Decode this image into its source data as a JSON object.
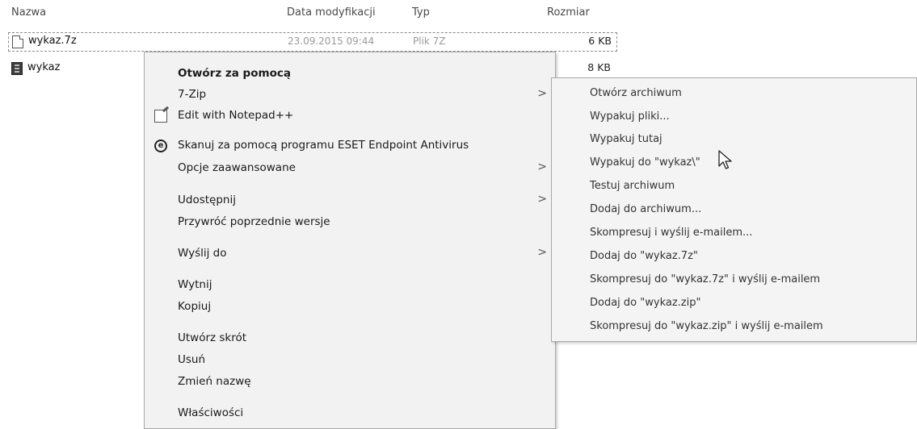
{
  "columns": {
    "name": "Nazwa",
    "modified": "Data modyfikacji",
    "type": "Typ",
    "size": "Rozmiar"
  },
  "files": [
    {
      "name": "wykaz.7z",
      "modified": "23.09.2015 09:44",
      "type": "Plik 7Z",
      "size": "6 KB",
      "icon": "file-doc-icon"
    },
    {
      "name": "wykaz",
      "modified": "",
      "type": "",
      "size": "8 KB",
      "icon": "archive-folder-icon"
    }
  ],
  "context_menu": {
    "items": [
      {
        "label": "Otwórz za pomocą",
        "bold": true
      },
      {
        "label": "7-Zip",
        "submenu": true
      },
      {
        "label": "Edit with Notepad++",
        "icon": "notepad-plus-icon"
      },
      {
        "label": "Skanuj za pomocą programu ESET Endpoint Antivirus",
        "icon": "eset-icon"
      },
      {
        "label": "Opcje zaawansowane",
        "submenu": true
      },
      {
        "label": "Udostępnij",
        "submenu": true
      },
      {
        "label": "Przywróć poprzednie wersje"
      },
      {
        "label": "Wyślij do",
        "submenu": true
      },
      {
        "label": "Wytnij"
      },
      {
        "label": "Kopiuj"
      },
      {
        "label": "Utwórz skrót"
      },
      {
        "label": "Usuń"
      },
      {
        "label": "Zmień nazwę"
      },
      {
        "label": "Właściwości"
      }
    ],
    "arrow": ">"
  },
  "sevenzip_submenu": {
    "items": [
      {
        "label": "Otwórz archiwum"
      },
      {
        "label": "Wypakuj pliki..."
      },
      {
        "label": "Wypakuj tutaj"
      },
      {
        "label": "Wypakuj do \"wykaz\\\""
      },
      {
        "label": "Testuj archiwum"
      },
      {
        "label": "Dodaj do archiwum..."
      },
      {
        "label": "Skompresuj i wyślij e-mailem..."
      },
      {
        "label": "Dodaj do \"wykaz.7z\""
      },
      {
        "label": "Skompresuj do \"wykaz.7z\" i wyślij e-mailem"
      },
      {
        "label": "Dodaj do \"wykaz.zip\""
      },
      {
        "label": "Skompresuj do \"wykaz.zip\" i wyślij e-mailem"
      }
    ]
  },
  "icons": {
    "notepad": "N",
    "eset": "e"
  }
}
